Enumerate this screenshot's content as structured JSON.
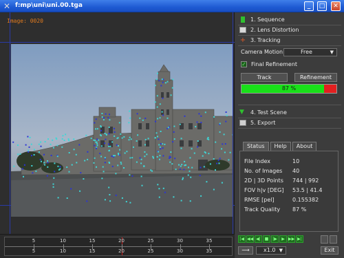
{
  "window": {
    "title": "f:mp\\uni\\uni.00.tga",
    "minimize": "_",
    "maximize": "□",
    "close": "✕"
  },
  "viewer": {
    "image_label": "Image: 0020"
  },
  "timeline": {
    "top_labels": [
      "5",
      "10",
      "15",
      "20",
      "25",
      "30",
      "35"
    ],
    "bottom_labels": [
      "5",
      "10",
      "15",
      "20",
      "25",
      "30",
      "35"
    ],
    "current": "20"
  },
  "steps": [
    {
      "label": "1. Sequence",
      "icon": "film-icon",
      "color": "#2fbf2f"
    },
    {
      "label": "2. Lens Distortion",
      "icon": "grid-icon",
      "color": "#cfcfcf"
    },
    {
      "label": "3. Tracking",
      "icon": "crosshair-icon",
      "color": "#e05a28"
    },
    {
      "label": "4. Test Scene",
      "icon": "triangle-icon",
      "color": "#2fbf2f"
    },
    {
      "label": "5. Export",
      "icon": "disk-icon",
      "color": "#cfcfcf"
    }
  ],
  "tracking": {
    "camera_motion_label": "Camera Motion",
    "camera_motion_value": "Free",
    "final_refinement_label": "Final Refinement",
    "final_refinement_checked": true,
    "track_button": "Track",
    "refinement_button": "Refinement",
    "progress_text": "87 %",
    "progress_fraction": 0.87
  },
  "tabs": [
    "Status",
    "Help",
    "About"
  ],
  "status": [
    {
      "key": "File Index",
      "value": "10"
    },
    {
      "key": "No. of Images",
      "value": "40"
    },
    {
      "key": "2D | 3D Points",
      "value": "744 | 992"
    },
    {
      "key": "FOV h|v [DEG]",
      "value": "53.5 | 41.4"
    },
    {
      "key": "RMSE [pel]",
      "value": "0.155382"
    },
    {
      "key": "Track Quality",
      "value": "87 %"
    }
  ],
  "transport": [
    "|◀",
    "◀◀",
    "◀|",
    "■",
    "|▶",
    "▶",
    "▶▶",
    "▶|"
  ],
  "zoom_value": "x1.0",
  "exit_button": "Exit",
  "colors": {
    "accent_green": "#19e019",
    "error_red": "#e32020",
    "marker_cyan": "#3fd6d6",
    "marker_blue": "#2b35d6"
  }
}
